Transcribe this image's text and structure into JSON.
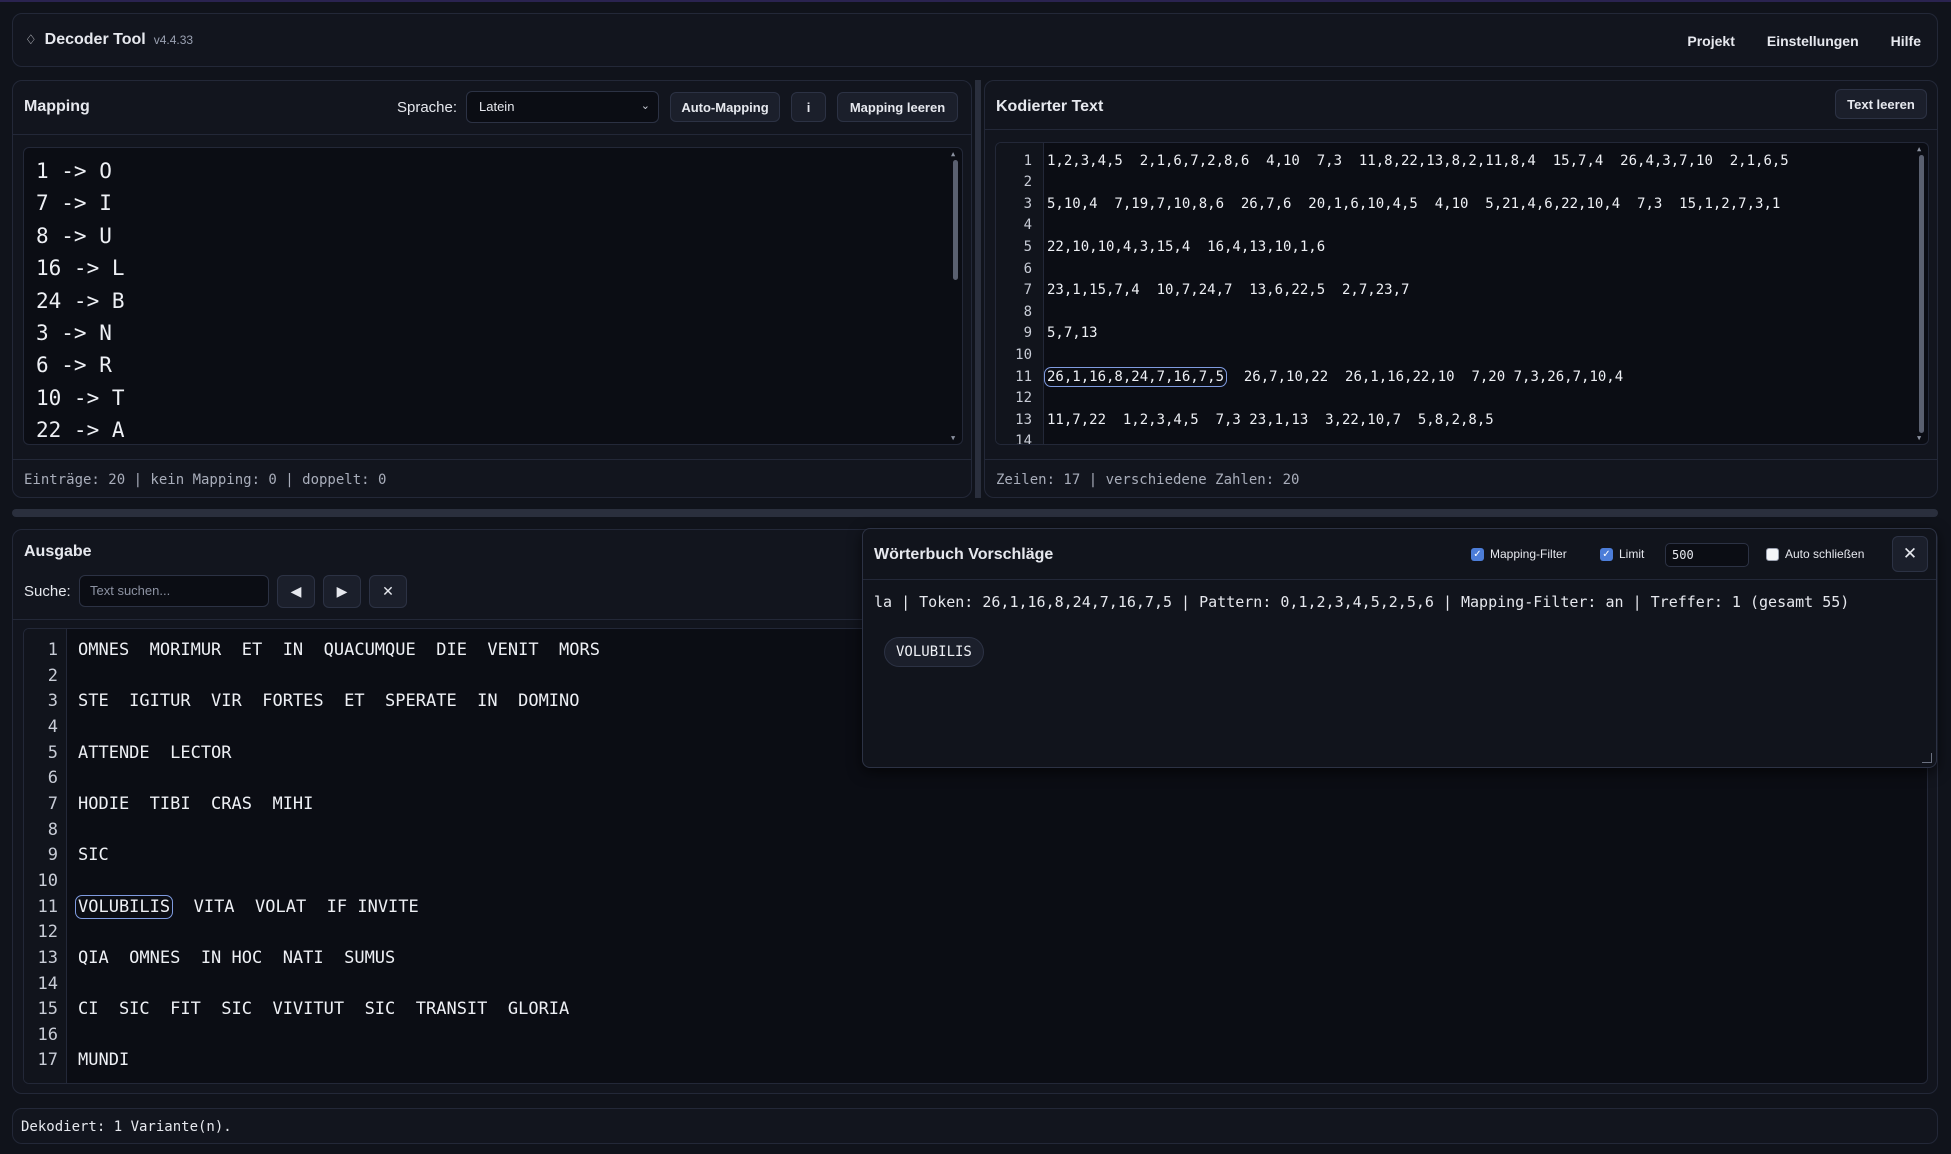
{
  "app": {
    "icon": "diamond-icon",
    "name": "Decoder Tool",
    "version": "v4.4.33"
  },
  "menu": [
    "Projekt",
    "Einstellungen",
    "Hilfe"
  ],
  "mapping": {
    "title": "Mapping",
    "language_label": "Sprache:",
    "language_value": "Latein",
    "auto_mapping": "Auto-Mapping",
    "info": "i",
    "clear": "Mapping leeren",
    "lines": [
      "1 -> O",
      "7 -> I",
      "8 -> U",
      "16 -> L",
      "24 -> B",
      "3 -> N",
      "6 -> R",
      "10 -> T",
      "22 -> A"
    ],
    "status": "Einträge: 20 | kein Mapping: 0 | doppelt: 0"
  },
  "encoded": {
    "title": "Kodierter Text",
    "clear": "Text leeren",
    "lines": [
      "1,2,3,4,5  2,1,6,7,2,8,6  4,10  7,3  11,8,22,13,8,2,11,8,4  15,7,4  26,4,3,7,10  2,1,6,5",
      "",
      "5,10,4  7,19,7,10,8,6  26,7,6  20,1,6,10,4,5  4,10  5,21,4,6,22,10,4  7,3  15,1,2,7,3,1",
      "",
      "22,10,10,4,3,15,4  16,4,13,10,1,6",
      "",
      "23,1,15,7,4  10,7,24,7  13,6,22,5  2,7,23,7",
      "",
      "5,7,13",
      "",
      "26,7,10,22  26,1,16,22,10  7,20 7,3,26,7,10,4",
      "",
      "11,7,22  1,2,3,4,5  7,3 23,1,13  3,22,10,7  5,8,2,8,5",
      ""
    ],
    "highlight_token": "26,1,16,8,24,7,16,7,5",
    "status": "Zeilen: 17 | verschiedene Zahlen: 20"
  },
  "output": {
    "title": "Ausgabe",
    "search_label": "Suche:",
    "search_placeholder": "Text suchen...",
    "prev_icon": "triangle-left-icon",
    "next_icon": "triangle-right-icon",
    "clear_icon": "close-icon",
    "lines": [
      "OMNES  MORIMUR  ET  IN  QUACUMQUE  DIE  VENIT  MORS",
      "",
      "STE  IGITUR  VIR  FORTES  ET  SPERATE  IN  DOMINO",
      "",
      "ATTENDE  LECTOR",
      "",
      "HODIE  TIBI  CRAS  MIHI",
      "",
      "SIC",
      "",
      "  VITA  VOLAT  IF INVITE",
      "",
      "QIA  OMNES  IN HOC  NATI  SUMUS",
      "",
      "CI  SIC  FIT  SIC  VIVITUT  SIC  TRANSIT  GLORIA",
      "",
      "MUNDI"
    ],
    "highlight_word": "VOLUBILIS"
  },
  "suggestions": {
    "title": "Wörterbuch Vorschläge",
    "mapping_filter_label": "Mapping-Filter",
    "mapping_filter_checked": true,
    "limit_label": "Limit",
    "limit_checked": true,
    "limit_value": "500",
    "auto_close_label": "Auto schließen",
    "auto_close_checked": false,
    "close_icon": "close-icon",
    "info": "la | Token: 26,1,16,8,24,7,16,7,5 | Pattern: 0,1,2,3,4,5,2,5,6 | Mapping-Filter: an | Treffer: 1 (gesamt 55)",
    "results": [
      "VOLUBILIS"
    ]
  },
  "footer": {
    "status": "Dekodiert: 1 Variante(n)."
  },
  "colors": {
    "background": "#10131b",
    "panel": "#12151e",
    "accent": "#4c7dd8",
    "highlight_border": "#7f9be0"
  }
}
